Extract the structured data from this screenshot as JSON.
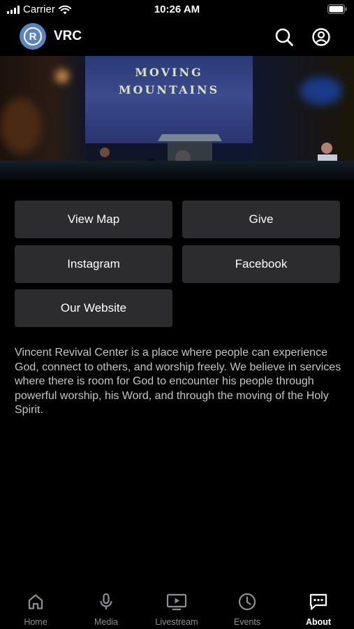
{
  "status_bar": {
    "carrier": "Carrier",
    "time": "10:26 AM",
    "icons": [
      "signal-icon",
      "wifi-icon",
      "battery-icon"
    ]
  },
  "header": {
    "logo_letter": "R",
    "title": "VRC",
    "icons": [
      "search-icon",
      "account-icon"
    ]
  },
  "hero": {
    "banner_line1": "MOVING",
    "banner_line2": "MOUNTAINS"
  },
  "actions": {
    "view_map": "View Map",
    "give": "Give",
    "instagram": "Instagram",
    "facebook": "Facebook",
    "website": "Our Website"
  },
  "description": "Vincent Revival Center is a place where people can experience God, connect to others, and worship freely. We believe in services where there is room for God to encounter his people through powerful worship, his Word, and through the moving of the Holy Spirit.",
  "tabs": [
    {
      "label": "Home",
      "icon": "home-icon",
      "active": false
    },
    {
      "label": "Media",
      "icon": "microphone-icon",
      "active": false
    },
    {
      "label": "Livestream",
      "icon": "tv-play-icon",
      "active": false
    },
    {
      "label": "Events",
      "icon": "clock-icon",
      "active": false
    },
    {
      "label": "About",
      "icon": "chat-bubble-icon",
      "active": true
    }
  ],
  "colors": {
    "background": "#000000",
    "button": "#2c2c2e",
    "logo": "#5a86bd",
    "tab_inactive": "#8e8e93",
    "tab_active": "#ffffff"
  }
}
